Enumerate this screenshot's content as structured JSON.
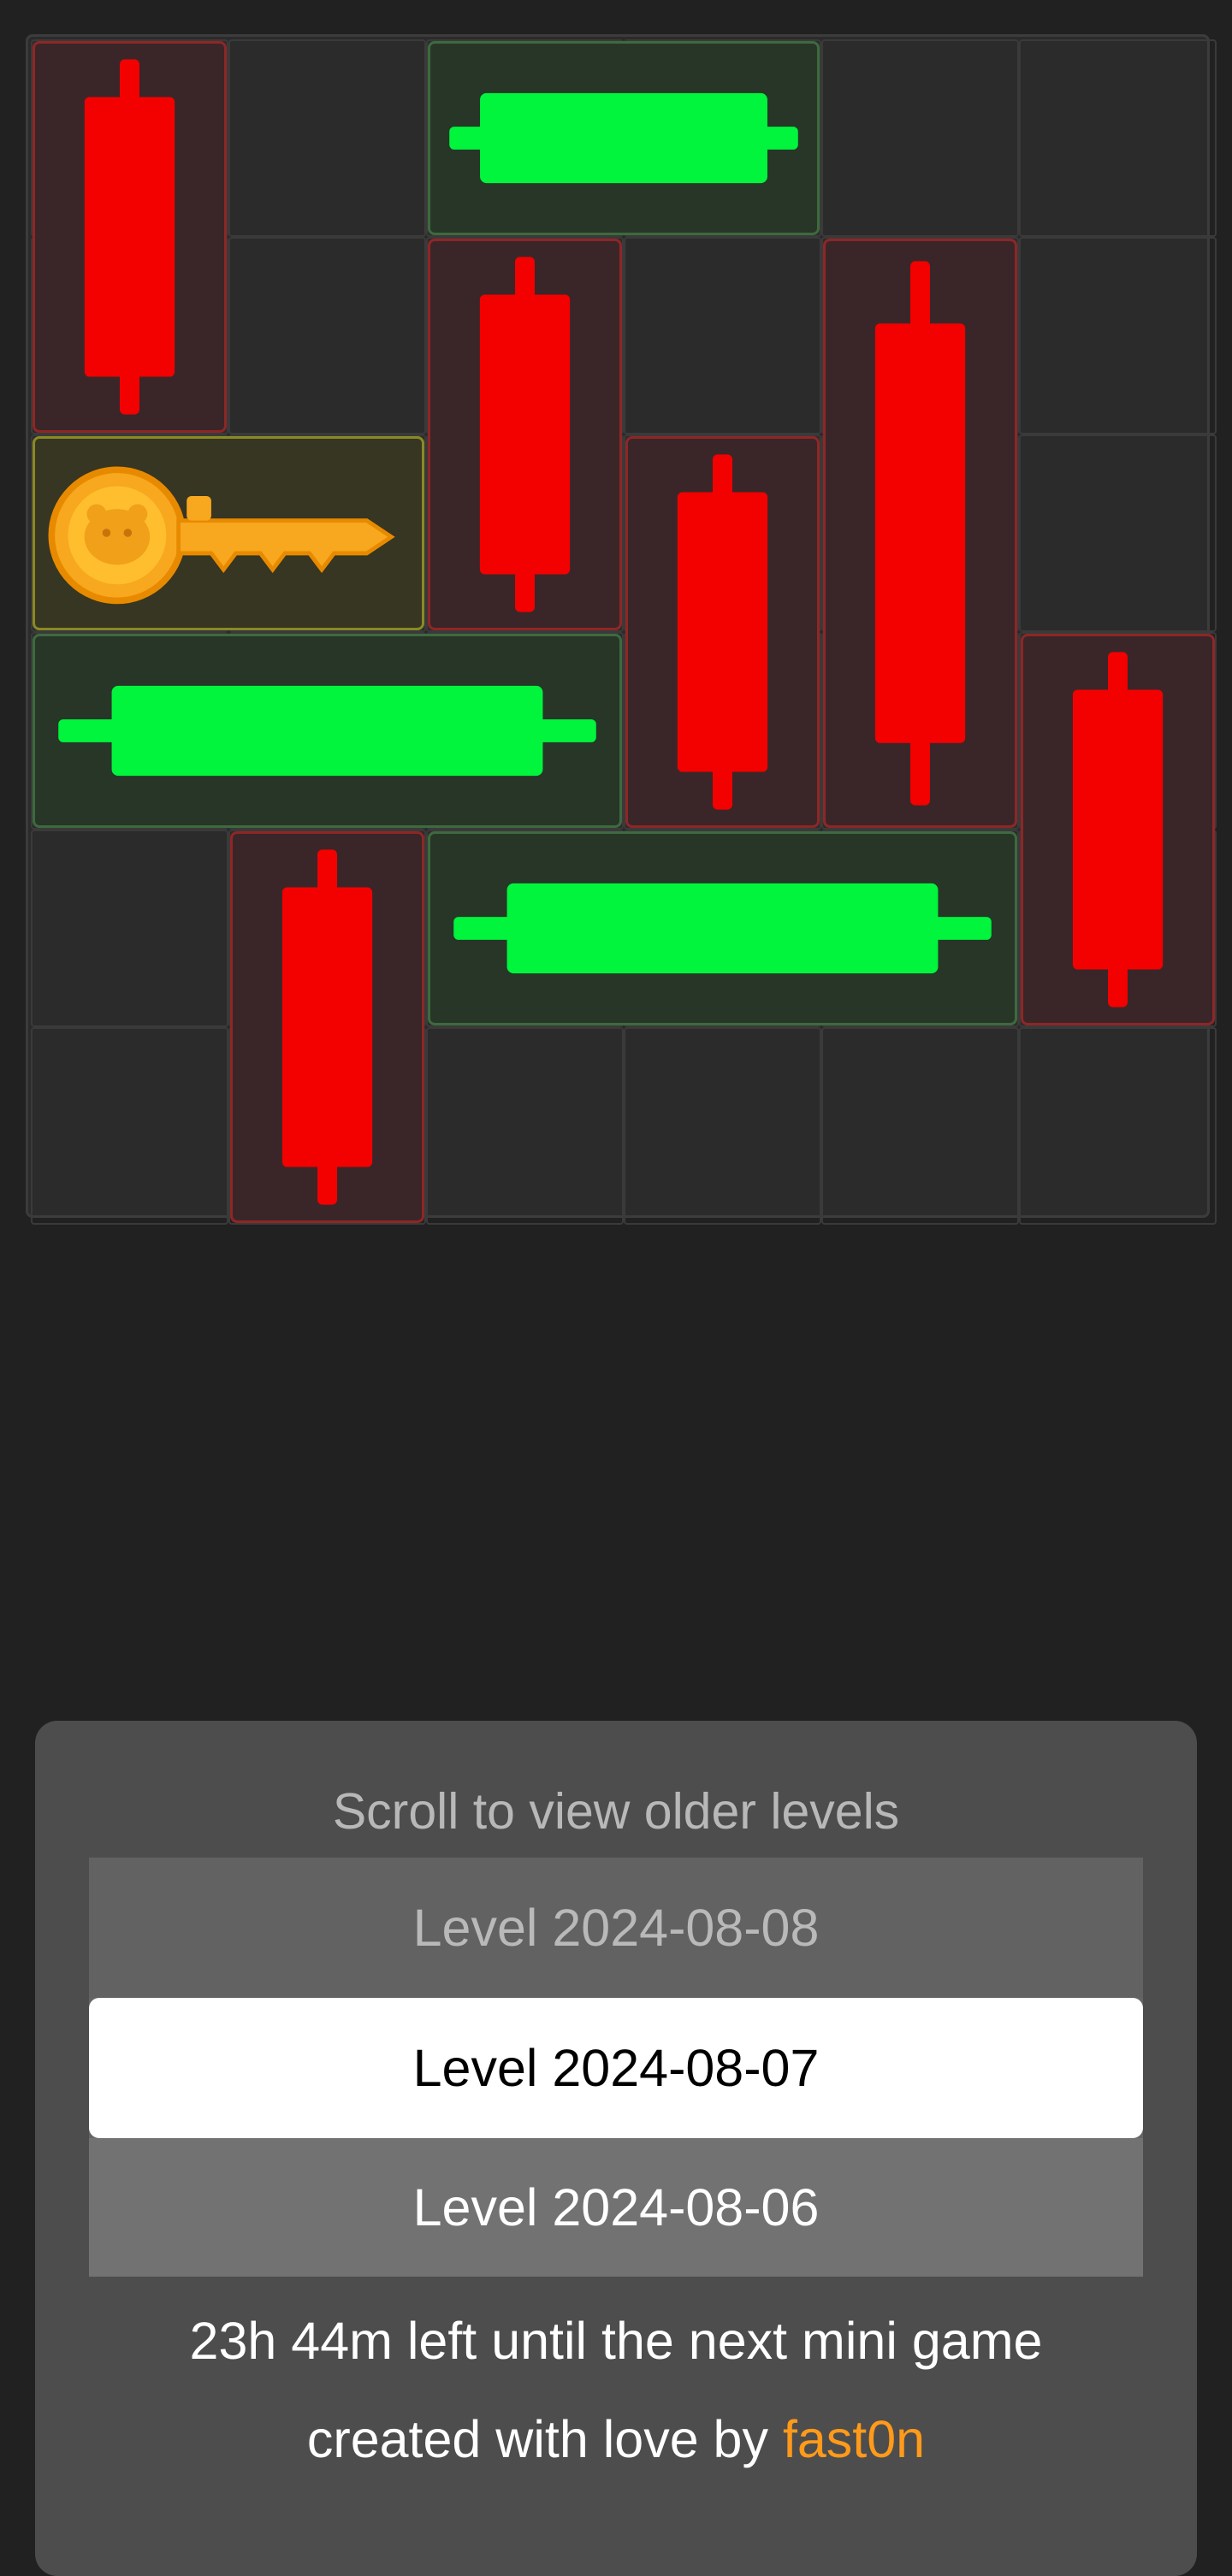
{
  "game": {
    "board": {
      "cols": 6,
      "rows": 6,
      "pieces": [
        {
          "id": "red-1",
          "kind": "red",
          "col": 0,
          "row": 0,
          "len": 2,
          "orient": "v"
        },
        {
          "id": "green-1",
          "kind": "green",
          "col": 2,
          "row": 0,
          "len": 2,
          "orient": "h"
        },
        {
          "id": "red-2",
          "kind": "red",
          "col": 2,
          "row": 1,
          "len": 2,
          "orient": "v"
        },
        {
          "id": "red-3",
          "kind": "red",
          "col": 4,
          "row": 1,
          "len": 3,
          "orient": "v"
        },
        {
          "id": "key",
          "kind": "key",
          "col": 0,
          "row": 2,
          "len": 2,
          "orient": "h"
        },
        {
          "id": "red-4",
          "kind": "red",
          "col": 3,
          "row": 2,
          "len": 2,
          "orient": "v"
        },
        {
          "id": "green-2",
          "kind": "green",
          "col": 0,
          "row": 3,
          "len": 3,
          "orient": "h"
        },
        {
          "id": "red-5",
          "kind": "red",
          "col": 5,
          "row": 3,
          "len": 2,
          "orient": "v"
        },
        {
          "id": "red-6",
          "kind": "red",
          "col": 1,
          "row": 4,
          "len": 2,
          "orient": "v"
        },
        {
          "id": "green-3",
          "kind": "green",
          "col": 2,
          "row": 4,
          "len": 3,
          "orient": "h"
        }
      ]
    },
    "colors": {
      "red": "#f30000",
      "green": "#00f53c",
      "key_gold": "#f7a81e",
      "author_link": "#ff9a1a"
    }
  },
  "level_picker": {
    "hint": "Scroll to view older levels",
    "levels": [
      "Level 2024-08-08",
      "Level 2024-08-07",
      "Level 2024-08-06"
    ],
    "selected": "Level 2024-08-07"
  },
  "footer": {
    "countdown": "23h 44m left until the next mini game",
    "credit_prefix": "created with love by ",
    "author": "fast0n"
  }
}
